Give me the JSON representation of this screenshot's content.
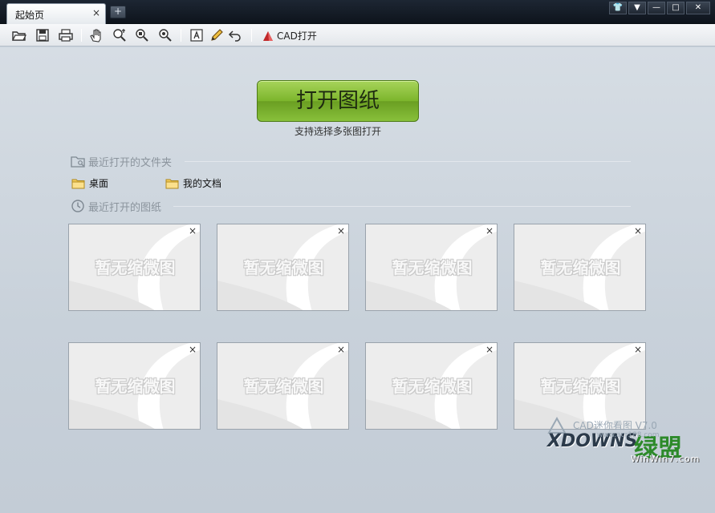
{
  "window": {
    "tab_label": "起始页",
    "tab_close": "×",
    "new_tab": "+",
    "controls": [
      "👕",
      "▼",
      "—",
      "□",
      "✕"
    ]
  },
  "toolbar": {
    "cad_open_label": "CAD打开"
  },
  "main": {
    "open_button_label": "打开图纸",
    "open_hint": "支持选择多张图打开",
    "recent_folders_title": "最近打开的文件夹",
    "folders": [
      "桌面",
      "我的文档"
    ],
    "recent_drawings_title": "最近打开的图纸",
    "thumbnails": [
      {
        "label": "暂无缩微图",
        "close": "×"
      },
      {
        "label": "暂无缩微图",
        "close": "×"
      },
      {
        "label": "暂无缩微图",
        "close": "×"
      },
      {
        "label": "暂无缩微图",
        "close": "×"
      },
      {
        "label": "暂无缩微图",
        "close": "×"
      },
      {
        "label": "暂无缩微图",
        "close": "×"
      },
      {
        "label": "暂无缩微图",
        "close": "×"
      },
      {
        "label": "暂无缩微图",
        "close": "×"
      }
    ]
  },
  "watermark": {
    "cad_text": "CAD迷你看图 V7.0",
    "site": "www.acr188.com",
    "downs": "XDOWNS",
    "logo_cn": "绿盟",
    "win": "WinWin7.com"
  },
  "colors": {
    "open_button": "#7cb52c",
    "titlebar": "#141c26",
    "background": "#c9d3dc"
  }
}
